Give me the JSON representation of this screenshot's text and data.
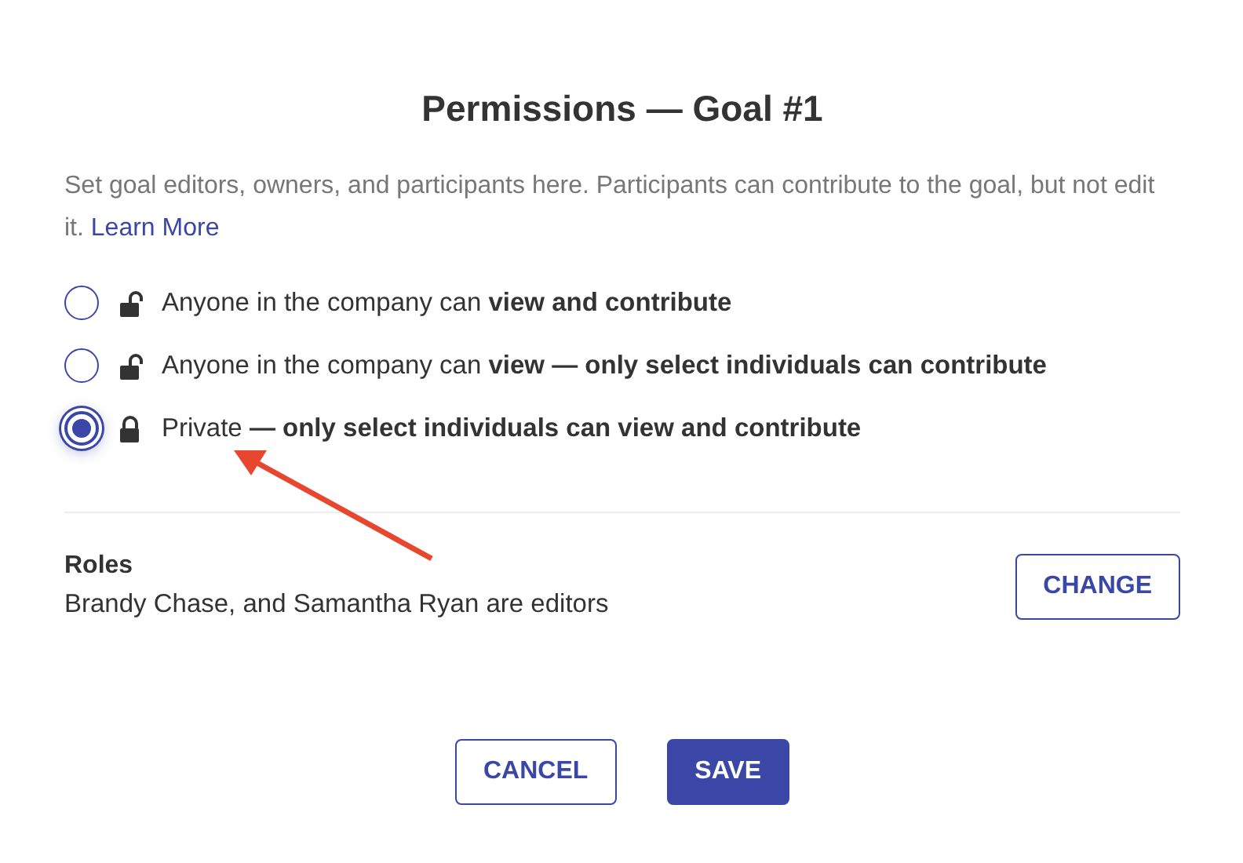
{
  "title": "Permissions — Goal #1",
  "description": {
    "text": "Set goal editors, owners, and participants here. Participants can contribute to the goal, but not edit it.",
    "link": "Learn More"
  },
  "options": [
    {
      "label": "Anyone in the company can **view and contribute**",
      "locked": false,
      "selected": false
    },
    {
      "label": "Anyone in the company can **view — only select individuals can contribute**",
      "locked": false,
      "selected": false
    },
    {
      "label": "Private **— only select individuals can view and contribute**",
      "locked": true,
      "selected": true
    }
  ],
  "roles": {
    "heading": "Roles",
    "text": "Brandy Chase, and Samantha Ryan are editors",
    "button": "CHANGE"
  },
  "buttons": [
    {
      "label": "CANCEL",
      "kind": "secondary"
    },
    {
      "label": "SAVE",
      "kind": "primary"
    }
  ]
}
